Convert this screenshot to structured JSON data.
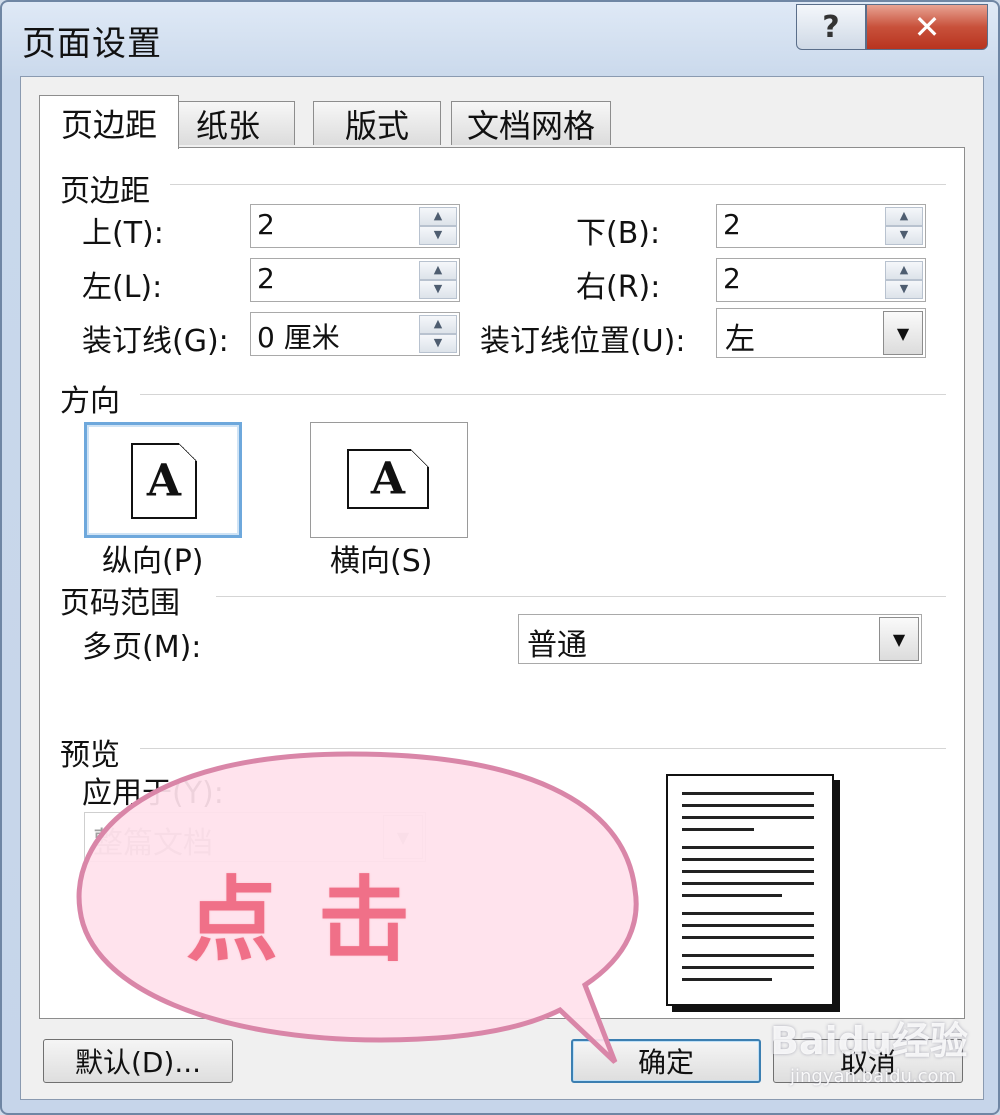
{
  "window": {
    "title": "页面设置",
    "help_glyph": "?",
    "close_glyph": "✕"
  },
  "tabs": [
    {
      "label": "页边距",
      "active": true
    },
    {
      "label": "纸张"
    },
    {
      "label": "版式"
    },
    {
      "label": "文档网格"
    }
  ],
  "margins": {
    "section_label": "页边距",
    "top": {
      "label": "上(T):",
      "value": "2"
    },
    "bottom": {
      "label": "下(B):",
      "value": "2"
    },
    "left": {
      "label": "左(L):",
      "value": "2"
    },
    "right": {
      "label": "右(R):",
      "value": "2"
    },
    "gutter": {
      "label": "装订线(G):",
      "value": "0 厘米"
    },
    "gutter_position": {
      "label": "装订线位置(U):",
      "value": "左"
    }
  },
  "orientation": {
    "section_label": "方向",
    "portrait_label": "纵向(P)",
    "landscape_label": "横向(S)",
    "selected": "portrait",
    "glyph": "A"
  },
  "pages": {
    "section_label": "页码范围",
    "multiple_label": "多页(M):",
    "multiple_value": "普通"
  },
  "preview": {
    "section_label": "预览",
    "apply_to_label": "应用于(Y):",
    "apply_to_value": "整篇文档"
  },
  "buttons": {
    "default": "默认(D)...",
    "ok": "确定",
    "cancel": "取消"
  },
  "annotation": {
    "callout_text": "点击",
    "callout_color": "#f07088"
  },
  "watermark": {
    "brand": "Baidu经验",
    "url": "jingyan.baidu.com"
  }
}
